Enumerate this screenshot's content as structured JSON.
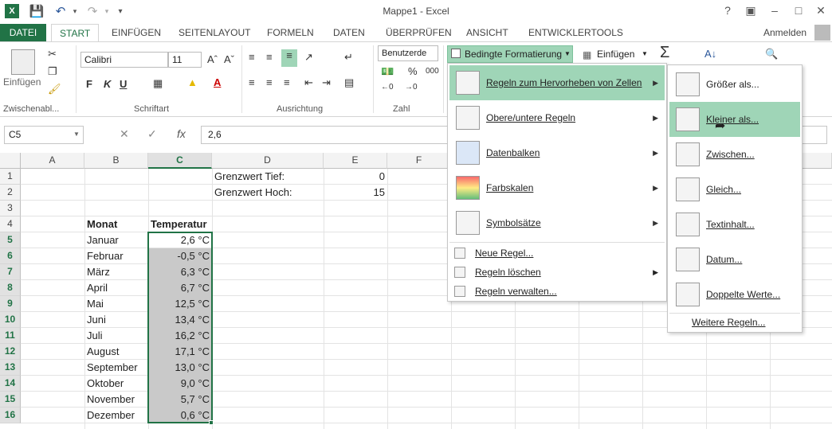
{
  "app": {
    "title": "Mappe1 - Excel",
    "signin": "Anmelden",
    "help": "?"
  },
  "tabs": [
    "DATEI",
    "START",
    "EINFÜGEN",
    "SEITENLAYOUT",
    "FORMELN",
    "DATEN",
    "ÜBERPRÜFEN",
    "ANSICHT",
    "ENTWICKLERTOOLS"
  ],
  "ribbon": {
    "paste_label": "Einfügen",
    "font_name": "Calibri",
    "font_size": "11",
    "number_format": "Benutzerde",
    "cond_format_label": "Bedingte Formatierung",
    "insert_label": "Einfügen",
    "groups": [
      "Zwischenabl...",
      "Schriftart",
      "Ausrichtung",
      "Zahl"
    ],
    "bold": "F",
    "italic": "K",
    "underline": "U",
    "percent": "%",
    "thousands": "000"
  },
  "formula": {
    "namebox": "C5",
    "fx": "fx",
    "value": "2,6"
  },
  "columns": [
    "A",
    "B",
    "C",
    "D",
    "E",
    "F"
  ],
  "rows": [
    "1",
    "2",
    "3",
    "4",
    "5",
    "6",
    "7",
    "8",
    "9",
    "10",
    "11",
    "12",
    "13",
    "14",
    "15",
    "16"
  ],
  "cells": {
    "d1": "Grenzwert Tief:",
    "e1": "0",
    "d2": "Grenzwert Hoch:",
    "e2": "15",
    "b4": "Monat",
    "c4": "Temperatur",
    "months": [
      "Januar",
      "Februar",
      "März",
      "April",
      "Mai",
      "Juni",
      "Juli",
      "August",
      "September",
      "Oktober",
      "November",
      "Dezember"
    ],
    "temps": [
      "2,6 °C",
      "-0,5 °C",
      "6,3 °C",
      "6,7 °C",
      "12,5 °C",
      "13,4 °C",
      "16,2 °C",
      "17,1 °C",
      "13,0 °C",
      "9,0 °C",
      "5,7 °C",
      "0,6 °C"
    ]
  },
  "menu": {
    "items": [
      "Regeln zum Hervorheben von Zellen",
      "Obere/untere Regeln",
      "Datenbalken",
      "Farbskalen",
      "Symbolsätze"
    ],
    "small": [
      "Neue Regel...",
      "Regeln löschen",
      "Regeln verwalten..."
    ]
  },
  "submenu": {
    "items": [
      "Größer als...",
      "Kleiner als...",
      "Zwischen...",
      "Gleich...",
      "Textinhalt...",
      "Datum...",
      "Doppelte Werte..."
    ],
    "more": "Weitere Regeln..."
  },
  "colors": {
    "excel_green": "#217346",
    "highlight": "#9fd5b7",
    "cell_grey": "#c9c9c9"
  }
}
